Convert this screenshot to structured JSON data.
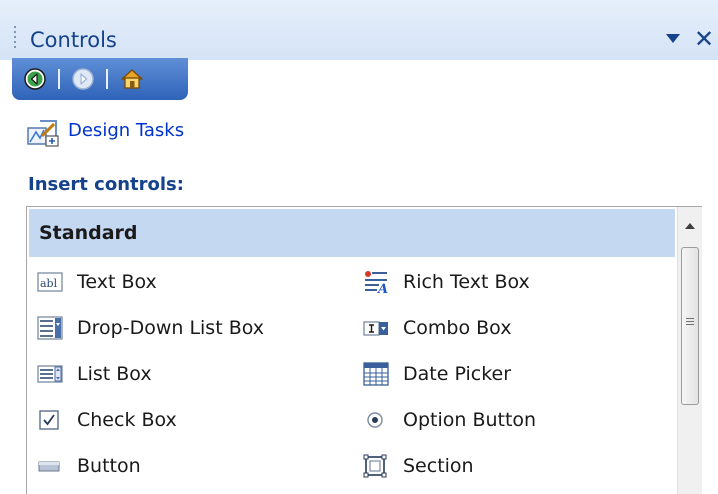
{
  "window": {
    "title": "Controls"
  },
  "nav": {
    "back": "back-icon",
    "forward": "forward-icon",
    "home": "home-icon"
  },
  "design_tasks": {
    "label": "Design Tasks",
    "icon": "design-tasks-icon"
  },
  "insert_controls": {
    "label": "Insert controls:"
  },
  "group": {
    "label": "Standard"
  },
  "controls": [
    {
      "label": "Text Box",
      "icon": "text-box-icon"
    },
    {
      "label": "Rich Text Box",
      "icon": "rich-text-box-icon"
    },
    {
      "label": "Drop-Down List Box",
      "icon": "drop-down-list-box-icon"
    },
    {
      "label": "Combo Box",
      "icon": "combo-box-icon"
    },
    {
      "label": "List Box",
      "icon": "list-box-icon"
    },
    {
      "label": "Date Picker",
      "icon": "date-picker-icon"
    },
    {
      "label": "Check Box",
      "icon": "check-box-icon"
    },
    {
      "label": "Option Button",
      "icon": "option-button-icon"
    },
    {
      "label": "Button",
      "icon": "button-icon"
    },
    {
      "label": "Section",
      "icon": "section-icon"
    }
  ],
  "colors": {
    "title_text": "#15428b",
    "nav_bar": "#2f63b9",
    "link": "#0033cc",
    "group_header": "#c5d8f1"
  }
}
